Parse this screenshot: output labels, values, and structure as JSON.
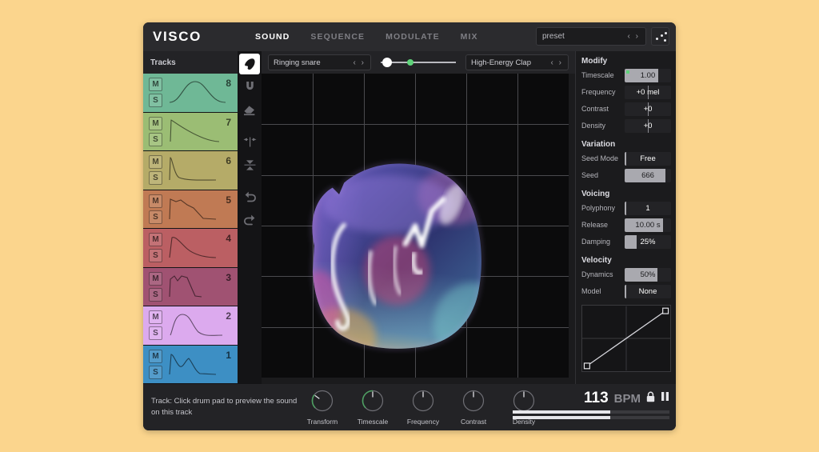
{
  "app": {
    "logo": "VISCO",
    "background_color": "#fbd58d",
    "window_color": "#1b1b1d",
    "accent_color": "#5fd37a"
  },
  "tabs": [
    {
      "label": "SOUND",
      "active": true
    },
    {
      "label": "SEQUENCE",
      "active": false
    },
    {
      "label": "MODULATE",
      "active": false
    },
    {
      "label": "MIX",
      "active": false
    }
  ],
  "preset": {
    "value": "preset",
    "prev_icon": "chevron-left-icon",
    "next_icon": "chevron-right-icon",
    "randomize_icon": "dice-icon"
  },
  "tracks": {
    "header": "Tracks",
    "mute_label": "M",
    "solo_label": "S",
    "items": [
      {
        "number": "8",
        "color": "#6fb896",
        "env": "hill"
      },
      {
        "number": "7",
        "color": "#9bbd74",
        "env": "ramp-down"
      },
      {
        "number": "6",
        "color": "#b5ab68",
        "env": "spike"
      },
      {
        "number": "5",
        "color": "#c07a54",
        "env": "plateau-fall"
      },
      {
        "number": "4",
        "color": "#bb5f63",
        "env": "decay"
      },
      {
        "number": "3",
        "color": "#a05272",
        "env": "double-hump"
      },
      {
        "number": "2",
        "color": "#dcaaee",
        "env": "bell"
      },
      {
        "number": "1",
        "color": "#3d8fc4",
        "env": "two-peak"
      }
    ]
  },
  "toolbar": [
    {
      "name": "brush-tool",
      "icon": "brush-icon",
      "active": true
    },
    {
      "name": "magnet-tool",
      "icon": "magnet-icon",
      "active": false
    },
    {
      "name": "eraser-tool",
      "icon": "eraser-icon",
      "active": false
    },
    {
      "name": "align-horizontal-tool",
      "icon": "align-horizontal-icon",
      "active": false
    },
    {
      "name": "align-vertical-tool",
      "icon": "align-vertical-icon",
      "active": false
    },
    {
      "name": "undo-tool",
      "icon": "undo-icon",
      "active": false
    },
    {
      "name": "redo-tool",
      "icon": "redo-icon",
      "active": false
    }
  ],
  "morph": {
    "source_a": "Ringing snare",
    "source_b": "High-Energy Clap",
    "handle_percent": 12,
    "dot_percent": 40
  },
  "stage": {
    "grid_columns": 6,
    "grid_rows": 6
  },
  "params": {
    "groups": [
      {
        "title": "Modify",
        "rows": [
          {
            "label": "Timescale",
            "value": "1.00",
            "fill": 72,
            "center": false,
            "dot": true,
            "dark_text": true
          },
          {
            "label": "Frequency",
            "value": "+0 mel",
            "fill": 0,
            "center": true,
            "dot": false,
            "dark_text": false
          },
          {
            "label": "Contrast",
            "value": "+0",
            "fill": 0,
            "center": true,
            "dot": false,
            "dark_text": false
          },
          {
            "label": "Density",
            "value": "+0",
            "fill": 0,
            "center": true,
            "dot": false,
            "dark_text": false
          }
        ]
      },
      {
        "title": "Variation",
        "rows": [
          {
            "label": "Seed Mode",
            "value": "Free",
            "fill": 4,
            "center": false,
            "dot": false,
            "dark_text": false
          },
          {
            "label": "Seed",
            "value": "666",
            "fill": 88,
            "center": false,
            "dot": false,
            "dark_text": true
          }
        ]
      },
      {
        "title": "Voicing",
        "rows": [
          {
            "label": "Polyphony",
            "value": "1",
            "fill": 4,
            "center": false,
            "dot": false,
            "dark_text": false
          },
          {
            "label": "Release",
            "value": "10.00 s",
            "fill": 82,
            "center": false,
            "dot": false,
            "dark_text": true
          },
          {
            "label": "Damping",
            "value": "25%",
            "fill": 26,
            "center": false,
            "dot": false,
            "dark_text": false
          }
        ]
      },
      {
        "title": "Velocity",
        "rows": [
          {
            "label": "Dynamics",
            "value": "50%",
            "fill": 70,
            "center": false,
            "dot": false,
            "dark_text": true
          },
          {
            "label": "Model",
            "value": "None",
            "fill": 4,
            "center": false,
            "dot": false,
            "dark_text": false
          }
        ]
      }
    ],
    "velocity_curve": {
      "name": "velocity-curve-editor",
      "points": [
        [
          0,
          0
        ],
        [
          100,
          100
        ]
      ]
    }
  },
  "bottom": {
    "hint": "Track: Click drum pad to preview the sound on this track",
    "knobs": [
      {
        "label": "Transform",
        "value": 30,
        "lit": true
      },
      {
        "label": "Timescale",
        "value": 50,
        "lit": true
      },
      {
        "label": "Frequency",
        "value": 50,
        "lit": false
      },
      {
        "label": "Contrast",
        "value": 50,
        "lit": false
      },
      {
        "label": "Density",
        "value": 50,
        "lit": false
      }
    ],
    "bpm": "113",
    "bpm_unit": "BPM",
    "lock_icon": "lock-icon",
    "pause_icon": "pause-icon",
    "meters": [
      62,
      62
    ]
  }
}
